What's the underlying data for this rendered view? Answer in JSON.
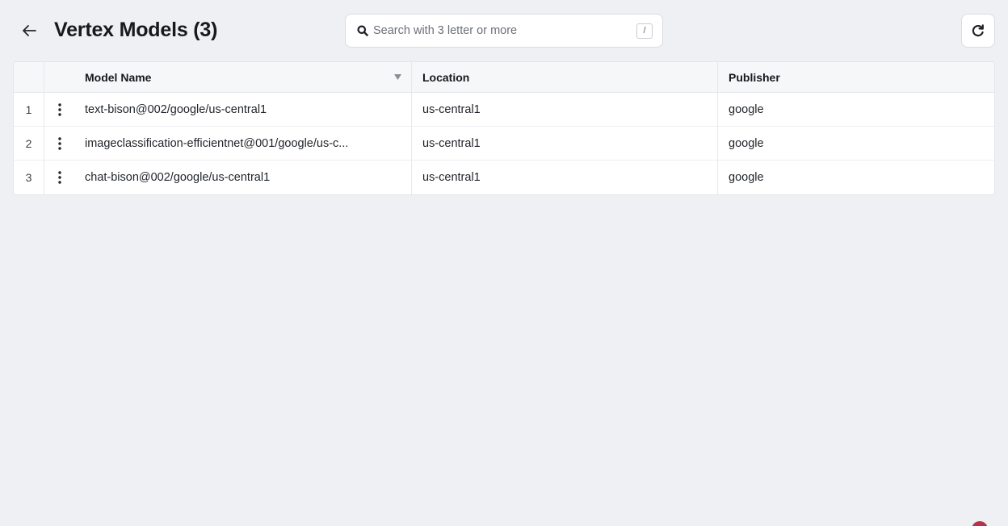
{
  "header": {
    "title": "Vertex Models (3)",
    "back_icon": "arrow-left-icon",
    "refresh_icon": "refresh-icon"
  },
  "search": {
    "placeholder": "Search with 3 letter or more",
    "value": "",
    "shortcut": "/",
    "icon": "search-icon"
  },
  "table": {
    "columns": {
      "name": "Model Name",
      "location": "Location",
      "publisher": "Publisher"
    },
    "rows": [
      {
        "index": "1",
        "name": "text-bison@002/google/us-central1",
        "location": "us-central1",
        "publisher": "google"
      },
      {
        "index": "2",
        "name": "imageclassification-efficientnet@001/google/us-c...",
        "location": "us-central1",
        "publisher": "google"
      },
      {
        "index": "3",
        "name": "chat-bison@002/google/us-central1",
        "location": "us-central1",
        "publisher": "google"
      }
    ]
  },
  "colors": {
    "background": "#eef0f3",
    "surface": "#ffffff",
    "header_row": "#f6f7f9",
    "border": "#e3e5e9",
    "text": "#1f2329",
    "corner_badge": "#b8324a"
  }
}
